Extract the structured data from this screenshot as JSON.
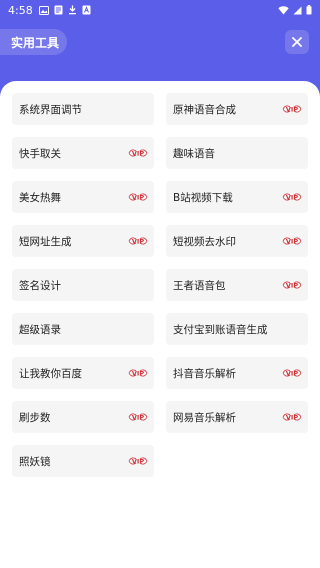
{
  "status_bar": {
    "time": "4:58",
    "left_icons": [
      "image-icon",
      "document-icon",
      "download-icon",
      "font-icon"
    ],
    "right_icons": [
      "wifi-icon",
      "signal-icon",
      "battery-icon"
    ]
  },
  "header": {
    "title": "实用工具",
    "close_icon": "close-icon"
  },
  "colors": {
    "header_bg": "#5b5ee8",
    "item_bg": "#f5f5f5",
    "vip": "#d0323a"
  },
  "vip_label": "VIP",
  "tools": [
    {
      "label": "系统界面调节",
      "vip": false
    },
    {
      "label": "原神语音合成",
      "vip": true
    },
    {
      "label": "快手取关",
      "vip": true
    },
    {
      "label": "趣味语音",
      "vip": false
    },
    {
      "label": "美女热舞",
      "vip": true
    },
    {
      "label": "B站视频下载",
      "vip": true
    },
    {
      "label": "短网址生成",
      "vip": true
    },
    {
      "label": "短视频去水印",
      "vip": true
    },
    {
      "label": "签名设计",
      "vip": false
    },
    {
      "label": "王者语音包",
      "vip": true
    },
    {
      "label": "超级语录",
      "vip": false
    },
    {
      "label": "支付宝到账语音生成",
      "vip": false
    },
    {
      "label": "让我教你百度",
      "vip": true
    },
    {
      "label": "抖音音乐解析",
      "vip": true
    },
    {
      "label": "刷步数",
      "vip": true
    },
    {
      "label": "网易音乐解析",
      "vip": true
    },
    {
      "label": "照妖镜",
      "vip": true
    }
  ]
}
